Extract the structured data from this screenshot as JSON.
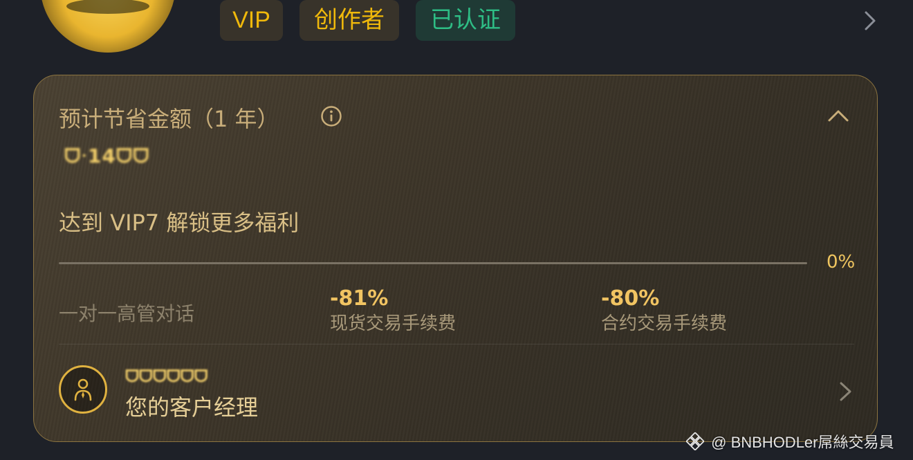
{
  "profile": {
    "badges": {
      "vip": "VIP",
      "creator": "创作者",
      "verified": "已认证"
    }
  },
  "savings_card": {
    "title": "预计节省金额（1 年）",
    "amount_obscured": "ᗜᐧ14ᗜᗜ",
    "vip_goal": "达到 VIP7 解锁更多福利",
    "progress": {
      "percent": 0,
      "text": "0%"
    },
    "benefits": {
      "executive_chat": "一对一高管对话",
      "spot": {
        "value": "-81%",
        "label": "现货交易手续费"
      },
      "futures": {
        "value": "-80%",
        "label": "合约交易手续费"
      }
    },
    "manager": {
      "name_obscured": "ᗜᗜᗜᗜᗜᗜ",
      "label": "您的客户经理"
    }
  },
  "watermark": {
    "text": "@ BNBHODLer屌絲交易員"
  },
  "colors": {
    "brand_yellow": "#f0b90b",
    "verified_green": "#2ebd85",
    "page_bg": "#1e2128",
    "card_border": "#8c7440"
  }
}
